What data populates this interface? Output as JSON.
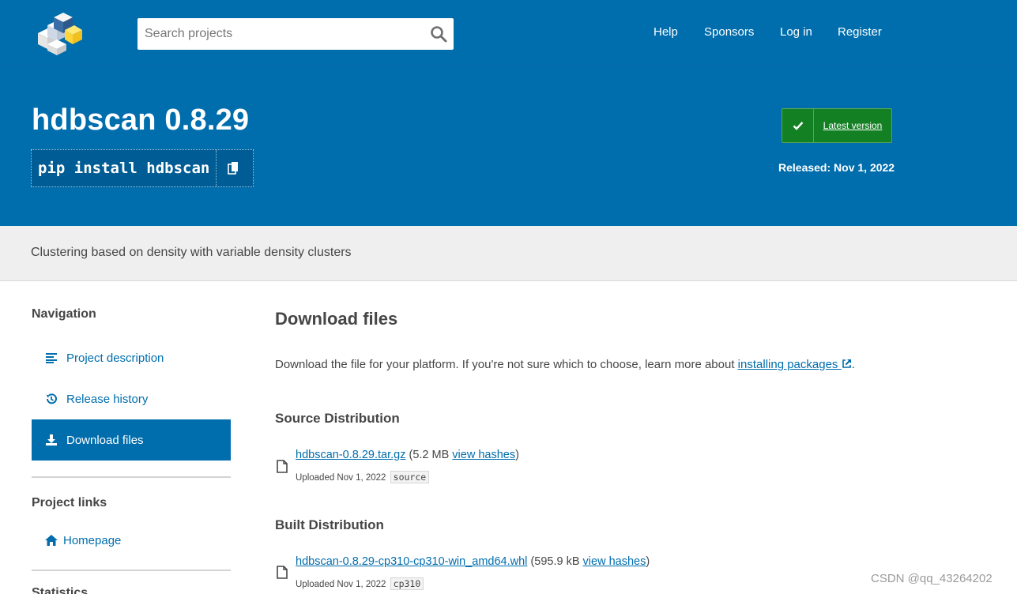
{
  "header": {
    "logo_alt": "PyPI",
    "search": {
      "placeholder": "Search projects"
    },
    "nav": [
      {
        "label": "Help"
      },
      {
        "label": "Sponsors"
      },
      {
        "label": "Log in"
      },
      {
        "label": "Register"
      }
    ]
  },
  "banner": {
    "title": "hdbscan 0.8.29",
    "pip_command": "pip install hdbscan",
    "latest_label": "Latest version",
    "released": "Released: Nov 1, 2022"
  },
  "summary": "Clustering based on density with variable density clusters",
  "sidebar": {
    "navigation_heading": "Navigation",
    "items": [
      {
        "label": "Project description",
        "icon": "align-left-icon"
      },
      {
        "label": "Release history",
        "icon": "history-icon"
      },
      {
        "label": "Download files",
        "icon": "download-icon",
        "active": true
      }
    ],
    "links_heading": "Project links",
    "links": [
      {
        "label": "Homepage",
        "icon": "home-icon"
      }
    ],
    "stats_heading": "Statistics"
  },
  "main": {
    "title": "Download files",
    "intro_text": "Download the file for your platform. If you're not sure which to choose, learn more about ",
    "intro_link": "installing packages",
    "intro_end": ".",
    "source_heading": "Source Distribution",
    "built_heading": "Built Distribution",
    "files": [
      {
        "name": "hdbscan-0.8.29.tar.gz",
        "size": "(5.2 MB ",
        "hashes": "view hashes",
        "close": ")",
        "uploaded": "Uploaded Nov 1, 2022",
        "tag": "source"
      },
      {
        "name": "hdbscan-0.8.29-cp310-cp310-win_amd64.whl",
        "size": "(595.9 kB ",
        "hashes": "view hashes",
        "close": ")",
        "uploaded": "Uploaded Nov 1, 2022",
        "tag": "cp310"
      }
    ]
  },
  "watermark": "CSDN @qq_43264202",
  "colors": {
    "brand_blue": "#006dad",
    "latest_green": "#148024",
    "summary_bg": "#efefef"
  }
}
